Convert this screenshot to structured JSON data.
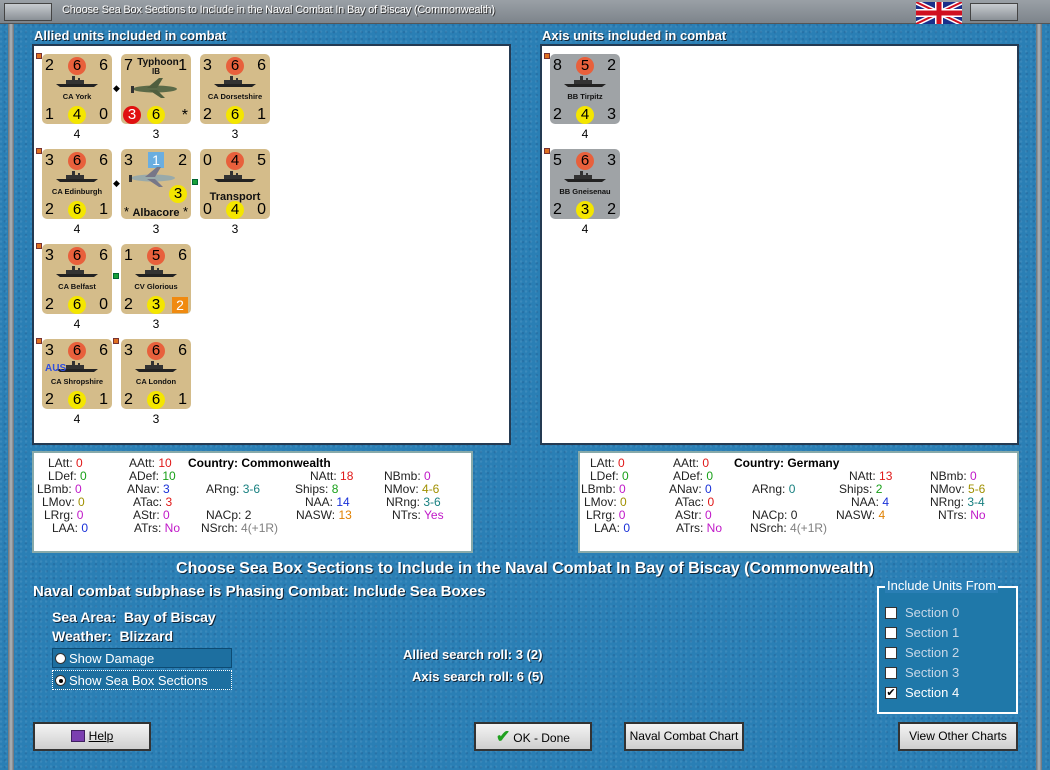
{
  "window": {
    "title": "Choose Sea Box Sections to Include in the Naval Combat In Bay of Biscay (Commonwealth)"
  },
  "allied": {
    "header": "Allied units included in combat",
    "counters": [
      {
        "tl": "2",
        "tc": "6",
        "tr": "6",
        "name": "CA York",
        "bl": "1",
        "bc": "4",
        "br": "0",
        "below": "4"
      },
      {
        "tl": "7",
        "name1": "Typhoon",
        "name2": "IB",
        "tr": "1",
        "bl": "3",
        "bc": "6",
        "br": "*",
        "below": "3"
      },
      {
        "tl": "3",
        "tc": "6",
        "tr": "6",
        "name": "CA Dorsetshire",
        "bl": "2",
        "bc": "6",
        "br": "1",
        "below": "3"
      },
      {
        "tl": "3",
        "tc": "6",
        "tr": "6",
        "name": "CA Edinburgh",
        "bl": "2",
        "bc": "6",
        "br": "1",
        "below": "4"
      },
      {
        "tl": "3",
        "tc": "1",
        "tr": "2",
        "name": "Albacore",
        "bl": "*",
        "bc": "3",
        "br": "*",
        "below": "3"
      },
      {
        "tl": "0",
        "tc": "4",
        "tr": "5",
        "name": "Transport",
        "bl": "0",
        "bc": "4",
        "br": "0",
        "below": "3"
      },
      {
        "tl": "3",
        "tc": "6",
        "tr": "6",
        "name": "CA Belfast",
        "bl": "2",
        "bc": "6",
        "br": "0",
        "below": "4"
      },
      {
        "tl": "1",
        "tc": "5",
        "tr": "6",
        "name": "CV Glorious",
        "bl": "2",
        "bc": "3",
        "br": "2",
        "below": "3"
      },
      {
        "tl": "3",
        "tc": "6",
        "tr": "6",
        "name": "CA Shropshire",
        "tag": "AUS",
        "bl": "2",
        "bc": "6",
        "br": "1",
        "below": "4"
      },
      {
        "tl": "3",
        "tc": "6",
        "tr": "6",
        "name": "CA London",
        "bl": "2",
        "bc": "6",
        "br": "1",
        "below": "3"
      }
    ]
  },
  "axis": {
    "header": "Axis units included in combat",
    "counters": [
      {
        "tl": "8",
        "tc": "5",
        "tr": "2",
        "name": "BB Tirpitz",
        "bl": "2",
        "bc": "4",
        "br": "3",
        "below": "4"
      },
      {
        "tl": "5",
        "tc": "6",
        "tr": "3",
        "name": "BB Gneisenau",
        "bl": "2",
        "bc": "3",
        "br": "2",
        "below": "4"
      }
    ]
  },
  "stats_left": {
    "country_label": "Country:",
    "country": "Commonwealth",
    "LAtt": "0",
    "LDef": "0",
    "LBmb": "0",
    "LMov": "0",
    "LRrg": "0",
    "LAA": "0",
    "AAtt": "10",
    "ADef": "10",
    "ANav": "3",
    "ATac": "3",
    "AStr": "0",
    "ATrs": "No",
    "ARng": "3-6",
    "NACp": "2",
    "NSrch": "4(+1R)",
    "NAtt": "18",
    "Ships": "8",
    "NAA": "14",
    "NASW": "13",
    "NBmb": "0",
    "NMov": "4-6",
    "NRng": "3-6",
    "NTrs": "Yes"
  },
  "stats_right": {
    "country_label": "Country:",
    "country": "Germany",
    "LAtt": "0",
    "LDef": "0",
    "LBmb": "0",
    "LMov": "0",
    "LRrg": "0",
    "LAA": "0",
    "AAtt": "0",
    "ADef": "0",
    "ANav": "0",
    "ATac": "0",
    "AStr": "0",
    "ATrs": "No",
    "ARng": "0",
    "NACp": "0",
    "NSrch": "4(+1R)",
    "NAtt": "13",
    "Ships": "2",
    "NAA": "4",
    "NASW": "4",
    "NBmb": "0",
    "NMov": "5-6",
    "NRng": "3-4",
    "NTrs": "No"
  },
  "main": {
    "title": "Choose Sea Box Sections to Include in the Naval Combat In Bay of Biscay (Commonwealth)",
    "subphase": "Naval combat subphase is Phasing Combat: Include Sea Boxes",
    "sea_area_label": "Sea Area:",
    "sea_area": "Bay of Biscay",
    "weather_label": "Weather:",
    "weather": "Blizzard",
    "radio_damage": "Show Damage",
    "radio_sections": "Show Sea Box Sections",
    "allied_roll": "Allied search roll: 3 (2)",
    "axis_roll": "Axis search roll: 6 (5)"
  },
  "include": {
    "legend": "Include Units From",
    "sections": [
      {
        "label": "Section 0",
        "checked": false
      },
      {
        "label": "Section 1",
        "checked": false
      },
      {
        "label": "Section 2",
        "checked": false
      },
      {
        "label": "Section 3",
        "checked": false
      },
      {
        "label": "Section 4",
        "checked": true
      }
    ]
  },
  "buttons": {
    "help": "Help",
    "ok": "OK - Done",
    "chart": "Naval Combat Chart",
    "other": "View Other Charts"
  },
  "colors": {
    "red": "#e01818",
    "green": "#18a018",
    "blue": "#1830d8",
    "purple": "#c018c8",
    "olive": "#a09000",
    "teal": "#188080",
    "orange": "#e08000",
    "gray": "#808080"
  }
}
